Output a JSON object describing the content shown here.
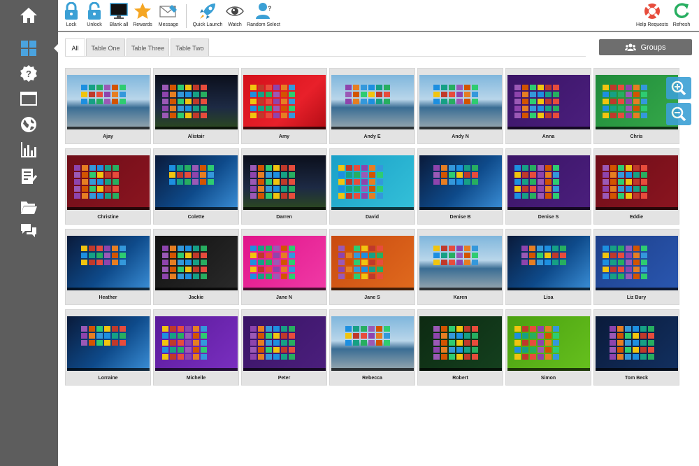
{
  "sidebar": {
    "items": [
      {
        "icon": "home-icon"
      },
      {
        "icon": "thumbnails-icon"
      },
      {
        "icon": "help-icon"
      },
      {
        "icon": "window-icon"
      },
      {
        "icon": "globe-icon"
      },
      {
        "icon": "bar-chart-icon"
      },
      {
        "icon": "checklist-icon"
      },
      {
        "icon": "folder-icon"
      },
      {
        "icon": "chat-icon"
      }
    ]
  },
  "toolbar": {
    "lock": "Lock",
    "unlock": "Unlock",
    "blank_all": "Blank all",
    "rewards": "Rewards",
    "message": "Message",
    "quick_launch": "Quick Launch",
    "watch": "Watch",
    "random_select": "Random Select",
    "help_requests": "Help Requests",
    "refresh": "Refresh"
  },
  "tabs": [
    {
      "label": "All",
      "active": true
    },
    {
      "label": "Table One",
      "active": false
    },
    {
      "label": "Table Three",
      "active": false
    },
    {
      "label": "Table Two",
      "active": false
    }
  ],
  "groups_button": "Groups",
  "students": [
    {
      "name": "Ajay",
      "theme": "beach"
    },
    {
      "name": "Alistair",
      "theme": "night"
    },
    {
      "name": "Amy",
      "theme": "red"
    },
    {
      "name": "Andy E",
      "theme": "beach"
    },
    {
      "name": "Andy N",
      "theme": "beach"
    },
    {
      "name": "Anna",
      "theme": "purple"
    },
    {
      "name": "Chris",
      "theme": "green"
    },
    {
      "name": "Christine",
      "theme": "maroon"
    },
    {
      "name": "Colette",
      "theme": "win10"
    },
    {
      "name": "Darren",
      "theme": "night"
    },
    {
      "name": "David",
      "theme": "cyan"
    },
    {
      "name": "Denise B",
      "theme": "win10"
    },
    {
      "name": "Denise S",
      "theme": "purple"
    },
    {
      "name": "Eddie",
      "theme": "maroon"
    },
    {
      "name": "Heather",
      "theme": "win10"
    },
    {
      "name": "Jackie",
      "theme": "dark"
    },
    {
      "name": "Jane N",
      "theme": "pink"
    },
    {
      "name": "Jane S",
      "theme": "orange"
    },
    {
      "name": "Karen",
      "theme": "beach"
    },
    {
      "name": "Lisa",
      "theme": "win10"
    },
    {
      "name": "Liz Bury",
      "theme": "blue"
    },
    {
      "name": "Lorraine",
      "theme": "win10"
    },
    {
      "name": "Michelle",
      "theme": "violet"
    },
    {
      "name": "Peter",
      "theme": "purple"
    },
    {
      "name": "Rebecca",
      "theme": "beach"
    },
    {
      "name": "Robert",
      "theme": "darkgreen"
    },
    {
      "name": "Simon",
      "theme": "lime"
    },
    {
      "name": "Tom Beck",
      "theme": "navy"
    }
  ],
  "zoom": {
    "in_icon": "zoom-in-icon",
    "out_icon": "zoom-out-icon"
  },
  "colors": {
    "sidebar": "#5d5d5d",
    "accent": "#3ba0d5",
    "groups_button": "#6e6e6e"
  }
}
